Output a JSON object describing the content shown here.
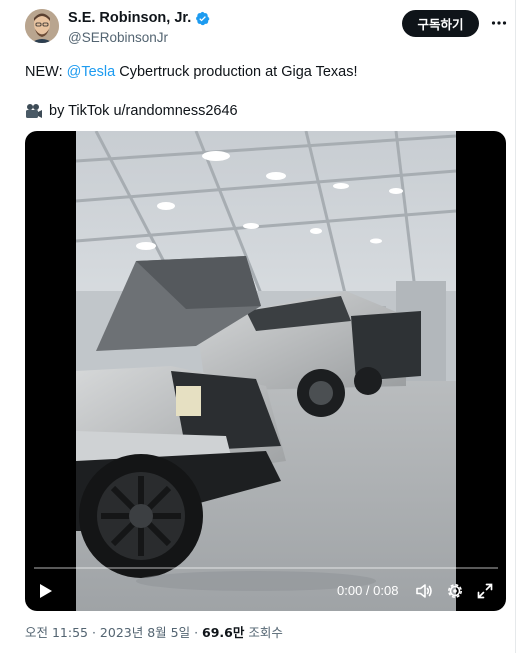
{
  "author": {
    "display_name": "S.E. Robinson, Jr.",
    "handle": "@SERobinsonJr",
    "verified_icon": "verified-badge-icon"
  },
  "header": {
    "follow_label": "구독하기",
    "more_icon": "more-icon"
  },
  "tweet": {
    "prefix": "NEW: ",
    "mention": "@Tesla",
    "suffix": " Cybertruck production at Giga Texas!",
    "credit": "by TikTok u/randomness2646",
    "credit_icon": "movie-camera-icon"
  },
  "video": {
    "time_display": "0:00 / 0:08",
    "progress": 0,
    "controls": [
      "play-icon",
      "volume-icon",
      "settings-icon",
      "fullscreen-icon"
    ]
  },
  "meta": {
    "time": "오전 11:55",
    "separator": " · ",
    "date": "2023년 8월 5일",
    "views_count": "69.6만",
    "views_label": " 조회수"
  },
  "colors": {
    "link": "#1d9bf0",
    "text": "#0f1419",
    "secondary": "#536471",
    "button_bg": "#0f1419"
  }
}
